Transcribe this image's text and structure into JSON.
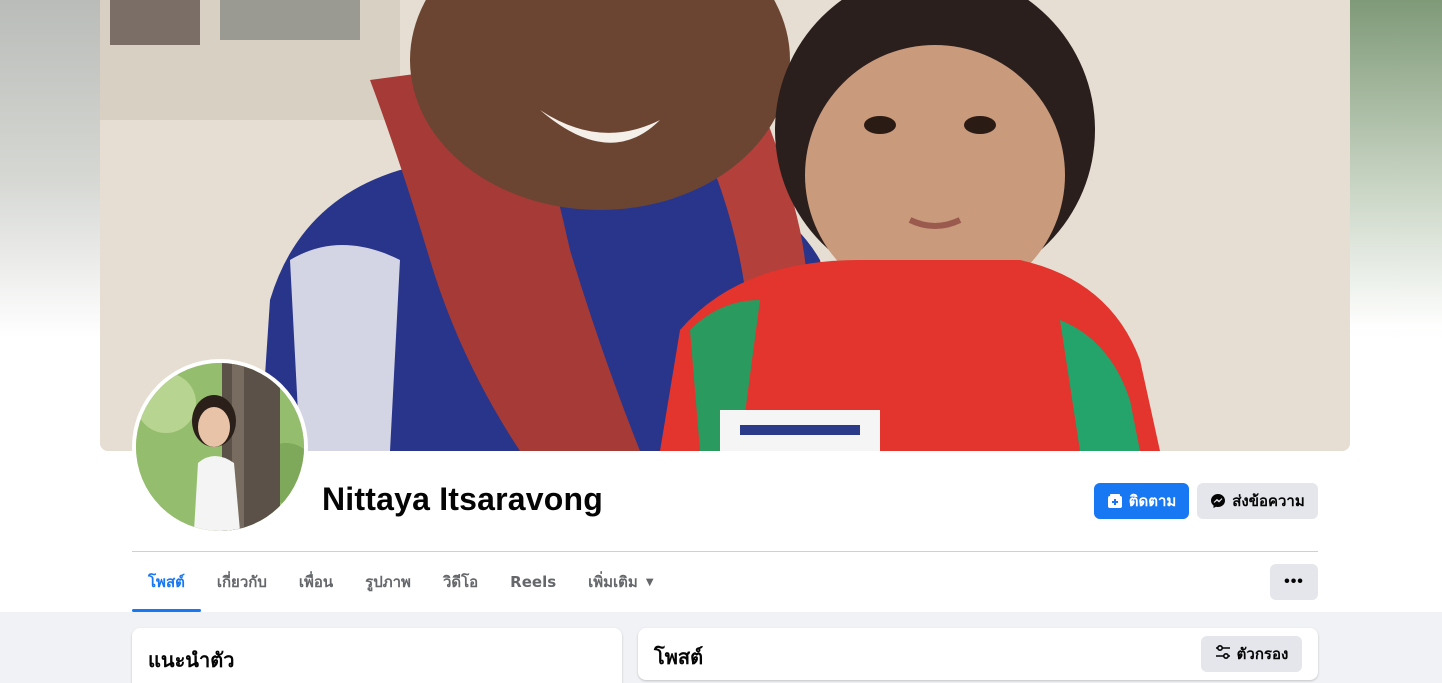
{
  "profile": {
    "name": "Nittaya Itsaravong"
  },
  "actions": {
    "follow_label": "ติดตาม",
    "message_label": "ส่งข้อความ",
    "more_label": "•••"
  },
  "tabs": [
    {
      "label": "โพสต์",
      "active": true
    },
    {
      "label": "เกี่ยวกับ"
    },
    {
      "label": "เพื่อน"
    },
    {
      "label": "รูปภาพ"
    },
    {
      "label": "วิดีโอ"
    },
    {
      "label": "Reels"
    },
    {
      "label": "เพิ่มเติม"
    }
  ],
  "intro": {
    "title": "แนะนำตัว"
  },
  "posts": {
    "title": "โพสต์",
    "filter_label": "ตัวกรอง"
  },
  "colors": {
    "accent": "#1877f2",
    "secondary_button": "#e4e6eb",
    "feed_background": "#f0f2f5"
  },
  "icons": {
    "follow": "user-add-icon",
    "message": "messenger-icon",
    "more": "ellipsis-icon",
    "filter": "sliders-icon",
    "tab_more": "caret-down-icon"
  }
}
